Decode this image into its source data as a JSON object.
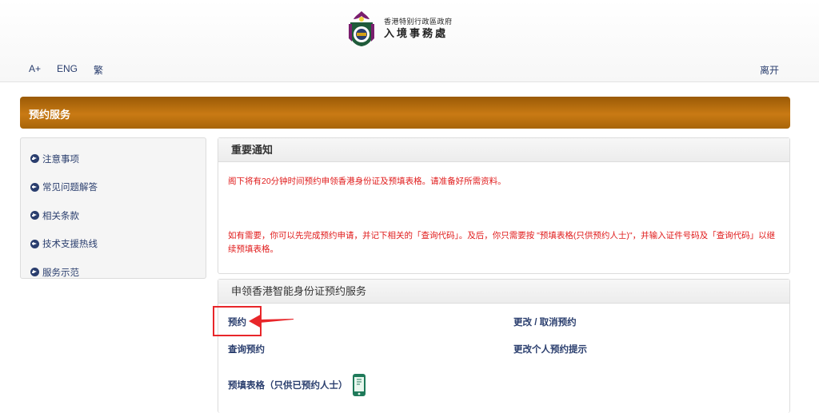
{
  "header": {
    "gov_name": "香港特别行政區政府",
    "dept_name": "入境事務處",
    "lang_links": [
      "A+",
      "ENG",
      "繁"
    ],
    "exit_label": "离开"
  },
  "banner": {
    "title": "预约服务"
  },
  "sidebar": {
    "items": [
      {
        "label": "注意事项"
      },
      {
        "label": "常见问题解答"
      },
      {
        "label": "相关条款"
      },
      {
        "label": "技术支援热线"
      },
      {
        "label": "服务示范"
      }
    ]
  },
  "notice": {
    "title": "重要通知",
    "para1": "阁下将有20分钟时间预约申领香港身份证及预填表格。请准备好所需资料。",
    "para2": "如有需要，你可以先完成预约申请，并记下相关的「查询代码」。及后，你只需要按 \"预填表格(只供预约人士)\"，并输入证件号码及「查询代码」以继续预填表格。"
  },
  "service": {
    "title": "申领香港智能身份证预约服务",
    "book_label": "预约",
    "query_label": "查询预约",
    "form_label": "预填表格（只供已预约人士）",
    "change_label": "更改 / 取消预约",
    "reminder_label": "更改个人预约提示"
  },
  "icons": {
    "emblem": "hksar-emblem-icon",
    "arrow": "circle-arrow-right-icon",
    "phone": "mobile-form-icon"
  },
  "colors": {
    "banner": "#b06b0b",
    "link": "#2a3e6e",
    "notice_text": "#e01b1b",
    "annotation": "#e8262a"
  }
}
